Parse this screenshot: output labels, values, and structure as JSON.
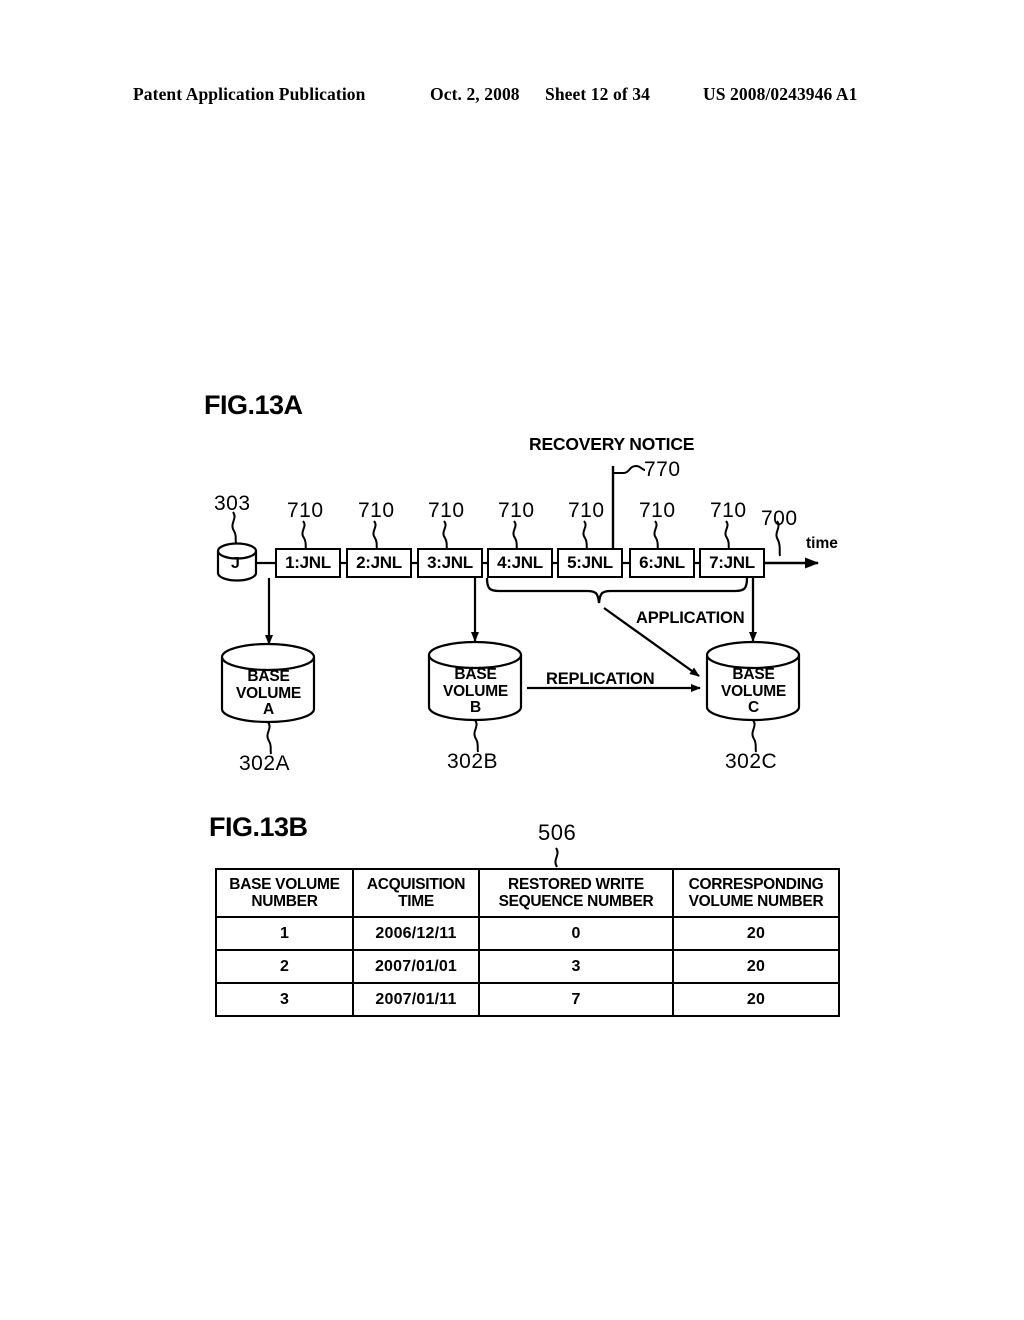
{
  "header": {
    "publication": "Patent Application Publication",
    "date": "Oct. 2, 2008",
    "sheet": "Sheet 12 of 34",
    "patent_number": "US 2008/0243946 A1"
  },
  "figures": {
    "fig_a_label": "FIG.13A",
    "fig_b_label": "FIG.13B"
  },
  "fig13a": {
    "recovery_notice_label": "RECOVERY NOTICE",
    "recovery_notice_ref": "770",
    "journal_cylinder_label": "J",
    "journal_ref": "303",
    "timeline_ref": "700",
    "time_axis_label": "time",
    "jnl_ref": "710",
    "jnl_boxes": [
      {
        "label": "1:JNL",
        "ref": "710"
      },
      {
        "label": "2:JNL",
        "ref": "710"
      },
      {
        "label": "3:JNL",
        "ref": "710"
      },
      {
        "label": "4:JNL",
        "ref": "710"
      },
      {
        "label": "5:JNL",
        "ref": "710"
      },
      {
        "label": "6:JNL",
        "ref": "710"
      },
      {
        "label": "7:JNL",
        "ref": "710"
      }
    ],
    "volumes": [
      {
        "label": "BASE\nVOLUME\nA",
        "ref": "302A"
      },
      {
        "label": "BASE\nVOLUME\nB",
        "ref": "302B"
      },
      {
        "label": "BASE\nVOLUME\nC",
        "ref": "302C"
      }
    ],
    "replication_label": "REPLICATION",
    "application_label": "APPLICATION"
  },
  "fig13b": {
    "table_ref": "506",
    "columns": [
      "BASE VOLUME\nNUMBER",
      "ACQUISITION\nTIME",
      "RESTORED WRITE\nSEQUENCE NUMBER",
      "CORRESPONDING\nVOLUME NUMBER"
    ],
    "rows": [
      {
        "base_volume_number": "1",
        "acquisition_time": "2006/12/11",
        "restored_write_sequence_number": "0",
        "corresponding_volume_number": "20"
      },
      {
        "base_volume_number": "2",
        "acquisition_time": "2007/01/01",
        "restored_write_sequence_number": "3",
        "corresponding_volume_number": "20"
      },
      {
        "base_volume_number": "3",
        "acquisition_time": "2007/01/11",
        "restored_write_sequence_number": "7",
        "corresponding_volume_number": "20"
      }
    ]
  },
  "colors": {
    "ink": "#000000",
    "paper": "#ffffff"
  }
}
